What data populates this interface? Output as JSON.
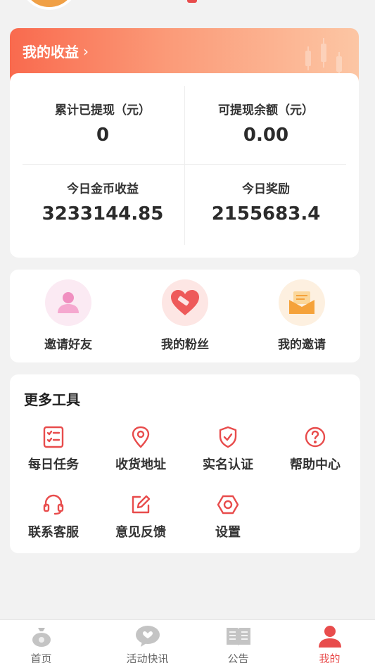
{
  "earnings": {
    "title": "我的收益",
    "chevron": "›",
    "withdrawn_label": "累计已提现（元）",
    "withdrawn_value": "0",
    "balance_label": "可提现余额（元）",
    "balance_value": "0.00",
    "today_coins_label": "今日金币收益",
    "today_coins_value": "3233144.85",
    "today_reward_label": "今日奖励",
    "today_reward_value": "2155683.4"
  },
  "quick_actions": {
    "invite_friends": {
      "label": "邀请好友",
      "icon": "user-icon"
    },
    "my_fans": {
      "label": "我的粉丝",
      "icon": "heart-icon"
    },
    "my_invites": {
      "label": "我的邀请",
      "icon": "envelope-icon"
    }
  },
  "tools": {
    "heading": "更多工具",
    "items": [
      {
        "label": "每日任务",
        "icon": "checklist-icon"
      },
      {
        "label": "收货地址",
        "icon": "location-pin-icon"
      },
      {
        "label": "实名认证",
        "icon": "shield-check-icon"
      },
      {
        "label": "帮助中心",
        "icon": "question-icon"
      },
      {
        "label": "联系客服",
        "icon": "headset-icon"
      },
      {
        "label": "意见反馈",
        "icon": "edit-icon"
      },
      {
        "label": "设置",
        "icon": "settings-hexagon-icon"
      }
    ]
  },
  "nav": {
    "home": "首页",
    "news": "活动快讯",
    "notice": "公告",
    "mine": "我的"
  },
  "colors": {
    "accent": "#e84c4c",
    "header_gradient_start": "#f96a4e",
    "header_gradient_end": "#fcc6a4",
    "background": "#f2f2f2"
  }
}
